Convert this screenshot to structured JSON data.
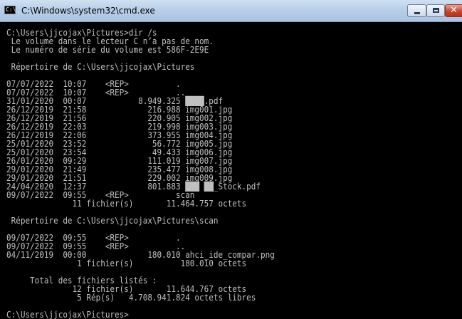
{
  "window": {
    "title": "C:\\Windows\\system32\\cmd.exe",
    "icon": "cmd-icon",
    "controls": {
      "minimize": "minimize-icon",
      "maximize": "maximize-icon",
      "close": "close-icon"
    }
  },
  "console": {
    "text_color": "#c0c0c0",
    "background": "#000000",
    "lines": [
      "C:\\Users\\jjcojax\\Pictures>dir /s",
      " Le volume dans le lecteur C n’a pas de nom.",
      " Le numéro de série du volume est 586F-2E9E",
      "",
      " Répertoire de C:\\Users\\jjcojax\\Pictures",
      "",
      "07/07/2022  10:07    <REP>          .",
      "07/07/2022  10:07    <REP>          ..",
      "31/01/2020  00:07           8.949.325 ████.pdf",
      "26/12/2019  21:58             216.988 img001.jpg",
      "26/12/2019  21:56             220.905 img002.jpg",
      "26/12/2019  22:03             219.998 img003.jpg",
      "26/12/2019  22:06             373.955 img004.jpg",
      "25/01/2020  23:52              56.772 img005.jpg",
      "25/01/2020  23:54              49.433 img006.jpg",
      "26/01/2020  09:29             111.019 img007.jpg",
      "29/01/2020  21:49             235.477 img008.jpg",
      "29/01/2020  21:51             229.002 img009.jpg",
      "24/04/2020  12:37             801.883 ███ ██_Stock.pdf",
      "09/07/2022  09:55    <REP>          scan",
      "              11 fichier(s)       11.464.757 octets",
      "",
      " Répertoire de C:\\Users\\jjcojax\\Pictures\\scan",
      "",
      "09/07/2022  09:55    <REP>          .",
      "09/07/2022  09:55    <REP>          ..",
      "04/11/2019  00:00             180.010 ahci_ide_compar.png",
      "               1 fichier(s)          180.010 octets",
      "",
      "     Total des fichiers listés :",
      "              12 fichier(s)       11.644.767 octets",
      "               5 Rép(s)   4.708.941.824 octets libres",
      "",
      "C:\\Users\\jjcojax\\Pictures>"
    ]
  }
}
